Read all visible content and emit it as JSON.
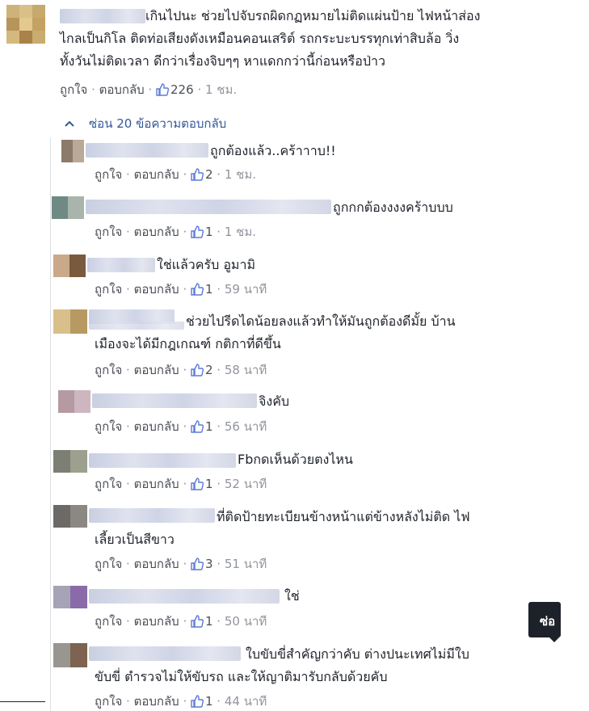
{
  "top_comment": {
    "lines": [
      "เกินไปนะ ช่วยไปจับรถผิดกฏหมายไม่ติดแผ่นป้าย ไฟหน้าส่อง",
      "ไกลเป็นกิโล ติดท่อเสียงดังเหมือนคอนเสริต์ รถกระบะบรรทุกเท่าสิบล้อ วิ่ง",
      "ทั้งวันไม่ติดเวลา ดีกว่าเรื่องจิบๆๆ หาแดกกว่านี้ก่อนหรือป่าว"
    ],
    "like_label": "ถูกใจ",
    "reply_label": "ตอบกลับ",
    "like_count": "226",
    "time": "1 ชม."
  },
  "hide_replies_label": "ซ่อน 20 ข้อความตอบกลับ",
  "replies": [
    {
      "lines": [
        "ถูกต้องแล้ว..คร้าาาบ!!"
      ],
      "like_label": "ถูกใจ",
      "reply_label": "ตอบกลับ",
      "like_count": "2",
      "time": "1 ชม."
    },
    {
      "lines": [
        "ถูกกกต้องงงงคร้าบบบ"
      ],
      "like_label": "ถูกใจ",
      "reply_label": "ตอบกลับ",
      "like_count": "1",
      "time": "1 ชม."
    },
    {
      "lines": [
        "ใช่แล้วครับ อูมามิ"
      ],
      "like_label": "ถูกใจ",
      "reply_label": "ตอบกลับ",
      "like_count": "1",
      "time": "59 นาที"
    },
    {
      "lines": [
        "ช่วยไปรีดไดน้อยลงแล้วทำให้มันถูกต้องดีมั้ย บ้าน",
        "เมืองจะได้มีกฎเกณฑ์ กติกาที่ดีขึ้น"
      ],
      "like_label": "ถูกใจ",
      "reply_label": "ตอบกลับ",
      "like_count": "2",
      "time": "58 นาที"
    },
    {
      "lines": [
        "จิงคับ"
      ],
      "like_label": "ถูกใจ",
      "reply_label": "ตอบกลับ",
      "like_count": "1",
      "time": "56 นาที"
    },
    {
      "lines": [
        "Fbกดเห็นด้วยตงไหน"
      ],
      "like_label": "ถูกใจ",
      "reply_label": "ตอบกลับ",
      "like_count": "1",
      "time": "52 นาที"
    },
    {
      "lines": [
        "ที่ติดป้ายทะเบียนข้างหน้าแต่ข้างหลังไม่ติด ไฟ",
        "เลี้ยวเป็นสีขาว"
      ],
      "like_label": "ถูกใจ",
      "reply_label": "ตอบกลับ",
      "like_count": "3",
      "time": "51 นาที"
    },
    {
      "lines": [
        "ใช่"
      ],
      "like_label": "ถูกใจ",
      "reply_label": "ตอบกลับ",
      "like_count": "1",
      "time": "50 นาที"
    },
    {
      "lines": [
        "ใบขับขี่สำคัญกว่าคับ ต่างปนะเทศไม่มีใบ",
        "ขับขี่ ตำรวจไม่ให้ขับรถ และให้ญาติมารับกลับด้วยคับ"
      ],
      "like_label": "ถูกใจ",
      "reply_label": "ตอบกลับ",
      "like_count": "1",
      "time": "44 นาที"
    }
  ],
  "tooltip_label": "ซ่อ",
  "icons": {
    "thumb": "thumbs-up-icon",
    "chevron": "chevron-up-icon"
  },
  "colors": {
    "link": "#365899",
    "like_icon": "#5b7bd5",
    "meta": "#90949c"
  }
}
